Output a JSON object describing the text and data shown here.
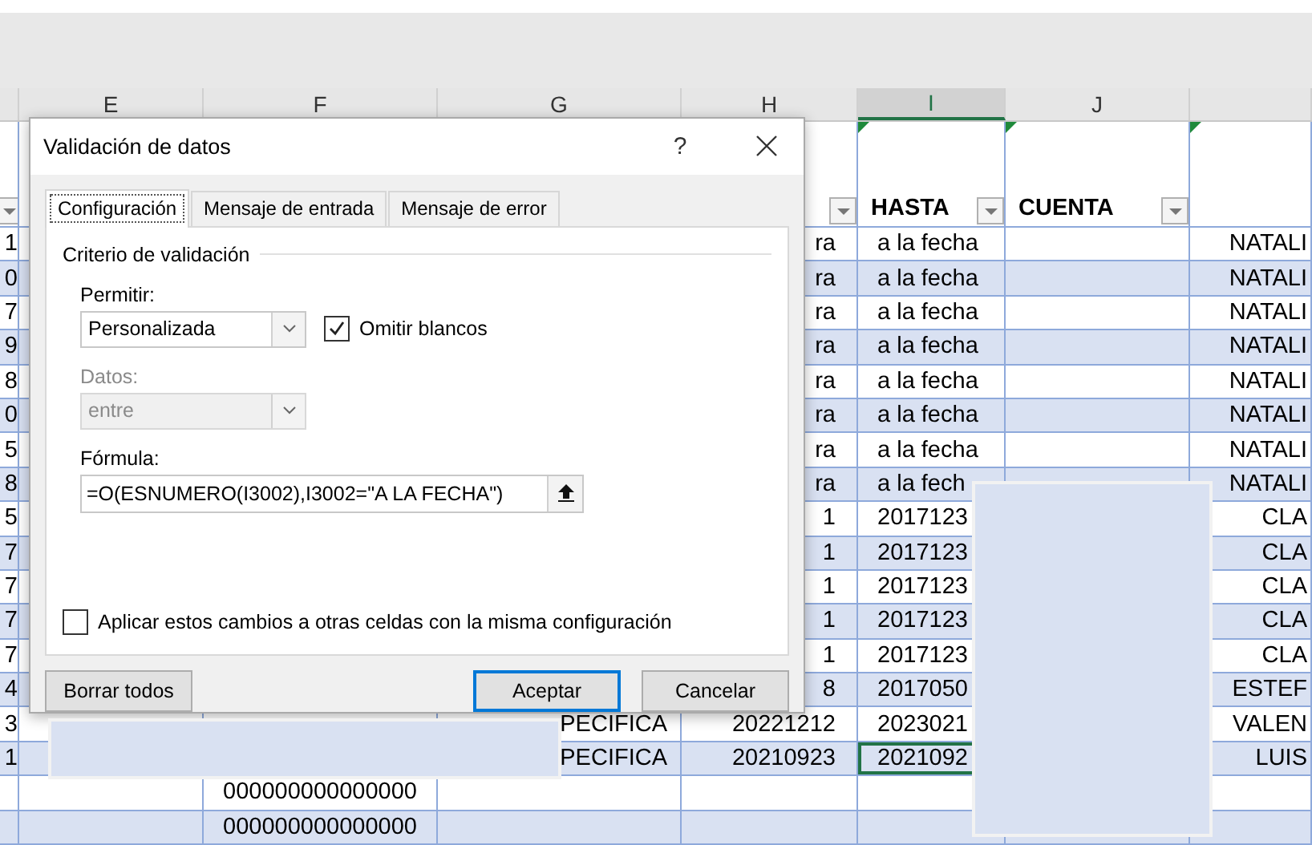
{
  "column_headers": [
    {
      "label": "E",
      "selected": false
    },
    {
      "label": "F",
      "selected": false
    },
    {
      "label": "G",
      "selected": false
    },
    {
      "label": "H",
      "selected": false
    },
    {
      "label": "I",
      "selected": true
    },
    {
      "label": "J",
      "selected": false
    }
  ],
  "sheet": {
    "header_row": [
      {
        "filter": true,
        "error_flag": false
      },
      {
        "filter": true,
        "error_flag": false
      },
      {
        "text": "HASTA",
        "filter": true,
        "error_flag": true
      },
      {
        "text": "CUENTA",
        "filter": true,
        "error_flag": true
      },
      {
        "filter": false,
        "error_flag": true
      }
    ],
    "rows": [
      {
        "cells": [
          "1",
          null,
          null,
          null,
          "ra",
          "a la fecha",
          null,
          "NATALI"
        ],
        "selected": false
      },
      {
        "cells": [
          "0",
          null,
          null,
          null,
          "ra",
          "a la fecha",
          null,
          "NATALI"
        ],
        "selected": false
      },
      {
        "cells": [
          "7",
          null,
          null,
          null,
          "ra",
          "a la fecha",
          null,
          "NATALI"
        ],
        "selected": false
      },
      {
        "cells": [
          "9",
          null,
          null,
          null,
          "ra",
          "a la fecha",
          null,
          "NATALI"
        ],
        "selected": false
      },
      {
        "cells": [
          "8",
          null,
          null,
          null,
          "ra",
          "a la fecha",
          null,
          "NATALI"
        ],
        "selected": false
      },
      {
        "cells": [
          "0",
          null,
          null,
          null,
          "ra",
          "a la fecha",
          null,
          "NATALI"
        ],
        "selected": false
      },
      {
        "cells": [
          "5",
          null,
          null,
          null,
          "ra",
          "a la fecha",
          null,
          "NATALI"
        ],
        "selected": false
      },
      {
        "cells": [
          "8",
          null,
          null,
          null,
          "ra",
          "a la fech",
          null,
          "NATALI"
        ],
        "selected": false
      },
      {
        "cells": [
          "5",
          null,
          null,
          null,
          "1",
          "2017123",
          null,
          "CLA"
        ],
        "selected": false
      },
      {
        "cells": [
          "7",
          null,
          null,
          null,
          "1",
          "2017123",
          null,
          "CLA"
        ],
        "selected": false
      },
      {
        "cells": [
          "7",
          null,
          null,
          null,
          "1",
          "2017123",
          null,
          "CLA"
        ],
        "selected": false
      },
      {
        "cells": [
          "7",
          null,
          null,
          null,
          "1",
          "2017123",
          null,
          "CLA"
        ],
        "selected": false
      },
      {
        "cells": [
          "7",
          null,
          null,
          null,
          "1",
          "2017123",
          null,
          "CLA"
        ],
        "selected": false
      },
      {
        "cells": [
          "4",
          null,
          null,
          null,
          "8",
          "2017050",
          null,
          "ESTEF"
        ],
        "selected": false
      },
      {
        "cells": [
          "3",
          null,
          null,
          "PECIFICA",
          "20221212",
          "2023021",
          null,
          "VALEN"
        ],
        "selected": false
      },
      {
        "cells": [
          "1",
          null,
          null,
          "PECIFICA",
          "20210923",
          "2021092",
          null,
          "LUIS"
        ],
        "selected": true
      },
      {
        "cells": [
          null,
          null,
          "000000000000000",
          null,
          null,
          null,
          null,
          null
        ],
        "selected": false
      },
      {
        "cells": [
          null,
          null,
          "000000000000000",
          null,
          null,
          null,
          null,
          null
        ],
        "selected": false
      }
    ]
  },
  "dialog": {
    "title": "Validación de datos",
    "help": "?",
    "tabs": [
      {
        "label": "Configuración",
        "selected": true
      },
      {
        "label": "Mensaje de entrada",
        "selected": false
      },
      {
        "label": "Mensaje de error",
        "selected": false
      }
    ],
    "group_title": "Criterio de validación",
    "allow": {
      "label": "Permitir:",
      "value": "Personalizada",
      "disabled": false
    },
    "ignore_blank": {
      "label": "Omitir blancos",
      "checked": true
    },
    "data": {
      "label": "Datos:",
      "value": "entre",
      "disabled": true
    },
    "formula": {
      "label": "Fórmula:",
      "value": "=O(ESNUMERO(I3002),I3002=\"A LA FECHA\")"
    },
    "apply_all": {
      "label": "Aplicar estos cambios a otras celdas con la misma configuración",
      "checked": false
    },
    "buttons": [
      {
        "label": "Borrar todos",
        "kind": "plain"
      },
      {
        "label": "Aceptar",
        "kind": "default"
      },
      {
        "label": "Cancelar",
        "kind": "plain"
      }
    ]
  }
}
